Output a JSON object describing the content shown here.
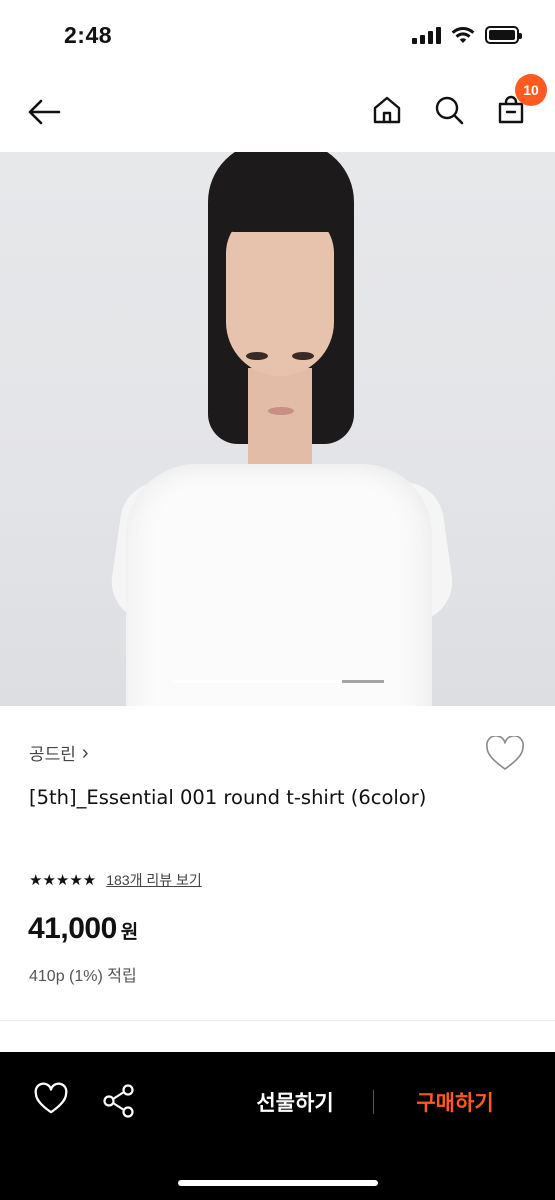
{
  "status_bar": {
    "time": "2:48"
  },
  "header": {
    "cart_count": "10"
  },
  "carousel": {
    "progress": 0.8
  },
  "product": {
    "brand": "공드린",
    "brand_chevron": "›",
    "name": "[5th]_Essential 001 round t-shirt (6color)",
    "stars": "★★★★★",
    "review_link": "183개 리뷰 보기",
    "price": "41,000",
    "currency": "원",
    "points": "410p (1%) 적립"
  },
  "bottom_bar": {
    "gift_label": "선물하기",
    "buy_label": "구매하기"
  },
  "colors": {
    "accent": "#ff5a1f",
    "bottom_bar_bg": "#000000"
  }
}
